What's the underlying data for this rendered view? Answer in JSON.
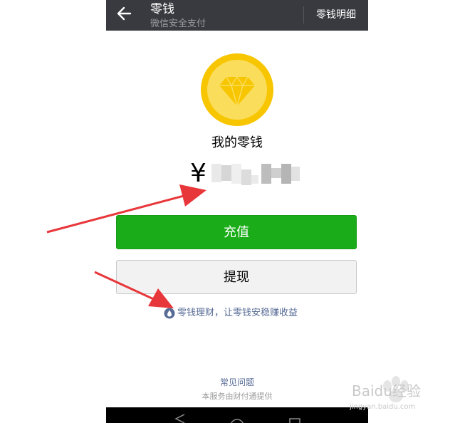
{
  "header": {
    "title": "零钱",
    "subtitle": "微信安全支付",
    "detail_link": "零钱明细"
  },
  "wallet": {
    "title": "我的零钱",
    "currency_symbol": "¥"
  },
  "actions": {
    "recharge_label": "充值",
    "withdraw_label": "提现"
  },
  "promo": {
    "text": "零钱理财，让零钱安稳赚收益"
  },
  "footer": {
    "faq_link": "常见问题",
    "provider_text": "本服务由财付通提供"
  },
  "watermark": {
    "brand": "Baidu经验",
    "site": "jingyan.baidu.com"
  },
  "colors": {
    "topbar": "#393a3f",
    "recharge": "#1aad19",
    "link": "#576b95",
    "coin": "#f7c600",
    "arrow": "#e8373a"
  }
}
